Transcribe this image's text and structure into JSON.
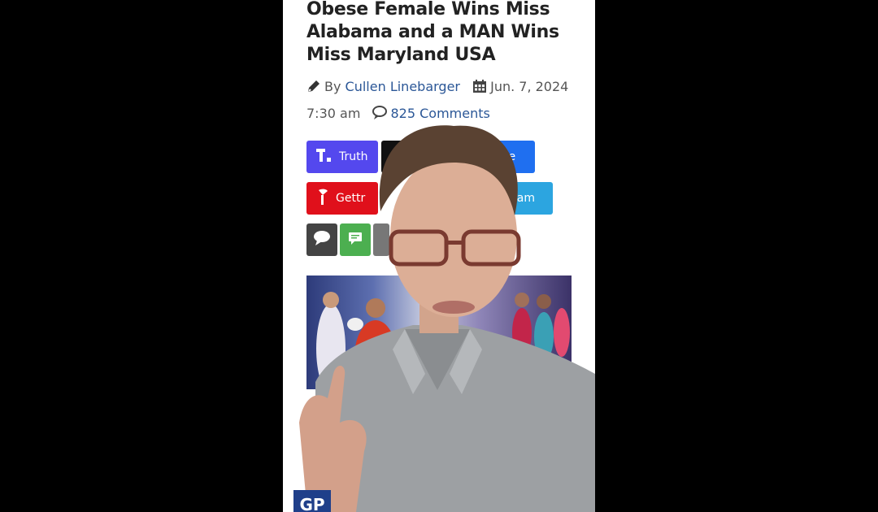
{
  "article": {
    "title": "Obese Female Wins Miss Alabama and a MAN Wins Miss Maryland USA",
    "by_prefix": "By",
    "author": "Cullen Linebarger",
    "date": "Jun. 7, 2024 7:30 am",
    "comments": "825 Comments",
    "icons": [
      "pencil-icon",
      "calendar-icon",
      "comments-icon"
    ]
  },
  "share": {
    "buttons": [
      {
        "label": "Truth",
        "color": "#5448ee"
      },
      {
        "label": "",
        "color": "#111111"
      },
      {
        "label": "re",
        "color": "#1f6ff0"
      },
      {
        "label": "Gettr",
        "color": "#e0101b"
      },
      {
        "label": "ram",
        "color": "#2ca5e0"
      }
    ],
    "small": [
      {
        "icon": "comment-bubble-icon",
        "color": "#444444"
      },
      {
        "icon": "sms-icon",
        "color": "#4caf50"
      }
    ]
  },
  "logo": {
    "text": "GP",
    "color": "#1f3f8a"
  },
  "colors": {
    "title": "#222222",
    "link": "#2b5797",
    "meta": "#555555"
  }
}
